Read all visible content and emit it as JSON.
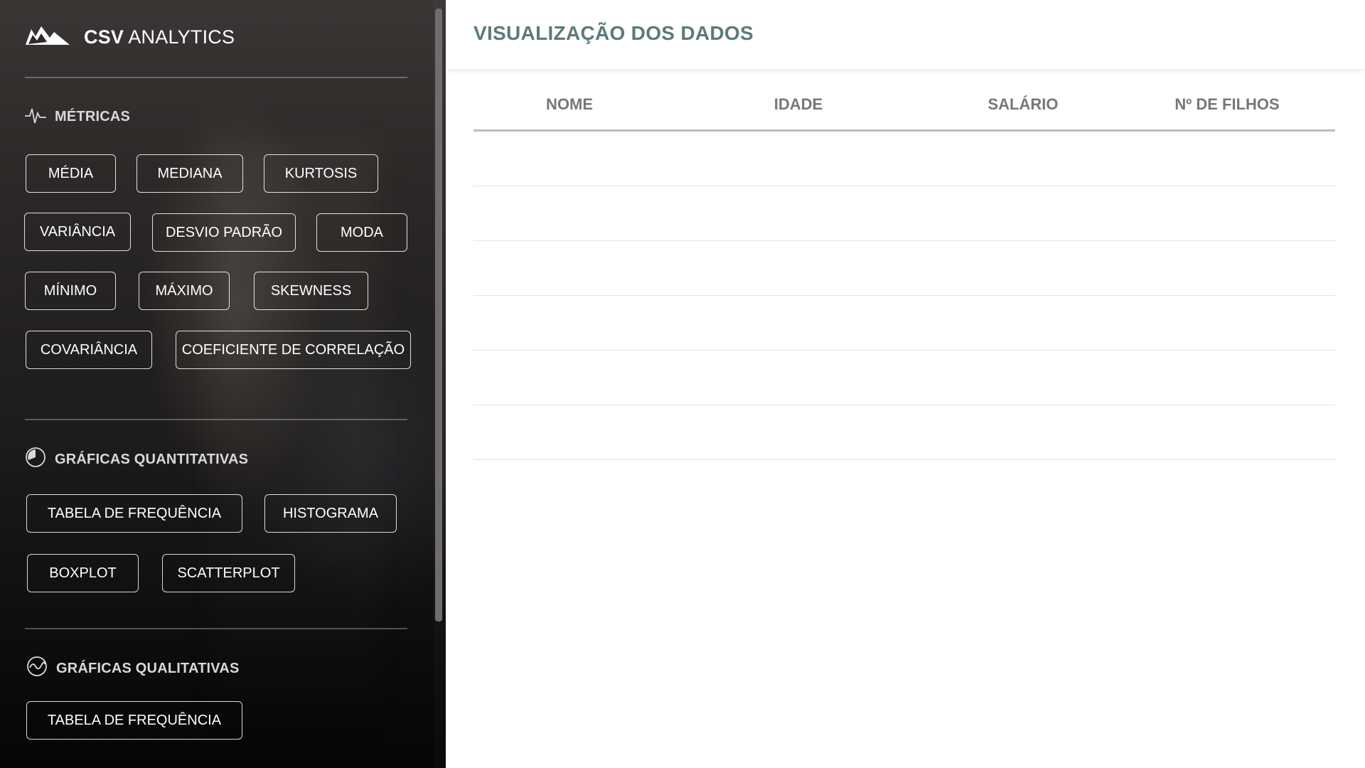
{
  "brand": {
    "name_bold": "CSV",
    "name_rest": "ANALYTICS",
    "icon": "mountain-logo-icon"
  },
  "sidebar": {
    "metricas": {
      "title": "MÉTRICAS",
      "icon": "pulse-icon",
      "buttons": [
        "MÉDIA",
        "MEDIANA",
        "KURTOSIS",
        "VARIÂNCIA",
        "DESVIO PADRÃO",
        "MODA",
        "MÍNIMO",
        "MÁXIMO",
        "SKEWNESS",
        "COVARIÂNCIA",
        "COEFICIENTE DE CORRELAÇÃO"
      ]
    },
    "quantitativas": {
      "title": "GRÁFICAS QUANTITATIVAS",
      "icon": "pie-chart-icon",
      "buttons": [
        "TABELA DE FREQUÊNCIA",
        "HISTOGRAMA",
        "BOXPLOT",
        "SCATTERPLOT"
      ]
    },
    "qualitativas": {
      "title": "GRÁFICAS QUALITATIVAS",
      "icon": "wave-circle-icon",
      "buttons": [
        "TABELA DE FREQUÊNCIA"
      ]
    }
  },
  "main": {
    "title": "VISUALIZAÇÃO DOS DADOS",
    "table": {
      "columns": [
        "NOME",
        "IDADE",
        "SALÁRIO",
        "Nº DE FILHOS"
      ],
      "rows": []
    }
  },
  "colors": {
    "title": "#5b7a7a",
    "header_text": "#777777",
    "chip_border": "#ffffff"
  }
}
